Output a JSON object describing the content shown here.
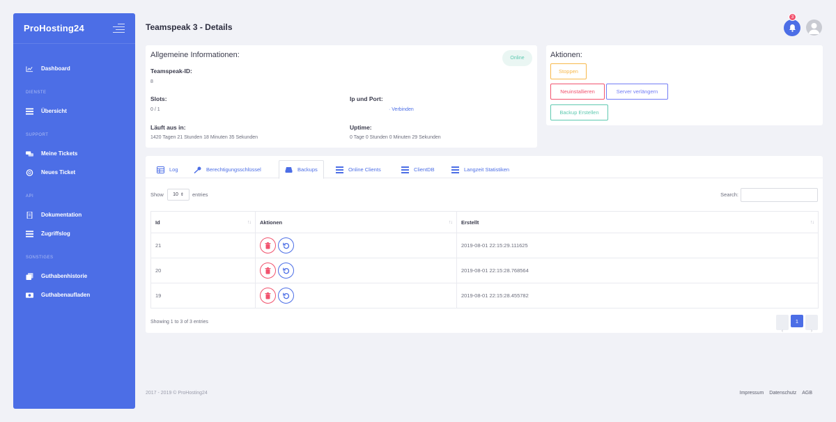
{
  "sidebar": {
    "brand": "ProHosting24",
    "items": [
      {
        "label": "Dashboard",
        "icon": "chart-icon"
      },
      {
        "section": "DIENSTE"
      },
      {
        "label": "Übersicht",
        "icon": "list-icon"
      },
      {
        "section": "SUPPORT"
      },
      {
        "label": "Meine Tickets",
        "icon": "tickets-icon"
      },
      {
        "label": "Neues Ticket",
        "icon": "lifebuoy-icon"
      },
      {
        "section": "API"
      },
      {
        "label": "Dokumentation",
        "icon": "book-icon"
      },
      {
        "label": "Zugriffslog",
        "icon": "list-icon"
      },
      {
        "section": "SONSTIGES"
      },
      {
        "label": "Guthabenhistorie",
        "icon": "history-icon"
      },
      {
        "label": "Guthabenaufladen",
        "icon": "money-icon"
      }
    ]
  },
  "header": {
    "title": "Teamspeak 3 - Details",
    "notification_count": "3"
  },
  "info": {
    "title": "Allgemeine Informationen:",
    "status": "Online",
    "teamspeak_id_label": "Teamspeak-ID:",
    "teamspeak_id": "8",
    "slots_label": "Slots:",
    "slots": "0 / 1",
    "ip_label": "Ip und Port:",
    "ip_link": "· Verbinden",
    "expires_label": "Läuft aus in:",
    "expires": "1420 Tagen 21 Stunden 18 Minuten 35 Sekunden",
    "uptime_label": "Uptime:",
    "uptime": "0 Tage 0 Stunden 0 Minuten 29 Sekunden"
  },
  "actions": {
    "title": "Aktionen:",
    "stop": "Stoppen",
    "reinstall": "Neuinstallieren",
    "extend": "Server verlängern",
    "backup": "Backup Erstellen"
  },
  "tabs": [
    {
      "label": "Log",
      "icon": "table-icon"
    },
    {
      "label": "Berechtigungsschlüssel",
      "icon": "key-icon"
    },
    {
      "label": "Backups",
      "icon": "database-icon"
    },
    {
      "label": "Online Clients",
      "icon": "list-icon"
    },
    {
      "label": "ClientDB",
      "icon": "list-icon"
    },
    {
      "label": "Langzeit Statistiken",
      "icon": "list-icon"
    }
  ],
  "table": {
    "show_label": "Show",
    "page_size": "10",
    "entries_label": "entries",
    "search_label": "Search:",
    "columns": [
      "Id",
      "Aktionen",
      "Erstellt"
    ],
    "rows": [
      {
        "id": "21",
        "created": "2019-08-01 22:15:29.111625"
      },
      {
        "id": "20",
        "created": "2019-08-01 22:15:28.768564"
      },
      {
        "id": "19",
        "created": "2019-08-01 22:15:28.455782"
      }
    ],
    "info": "Showing 1 to 3 of 3 entries",
    "current_page": "1"
  },
  "footer": {
    "copyright": "2017 - 2019 © ProHosting24",
    "links": [
      "Impressum",
      "Datenschutz",
      "AGB"
    ]
  },
  "colors": {
    "accent": "#4c6ee6",
    "danger": "#f1536e",
    "warning": "#f7b84b",
    "success": "#5ec9b0",
    "purple": "#727cf5"
  }
}
